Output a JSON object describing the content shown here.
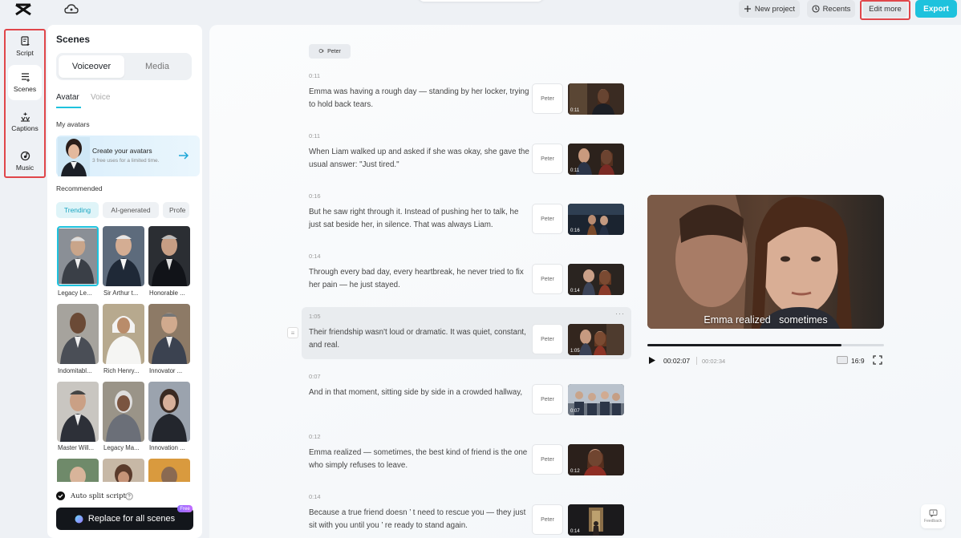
{
  "topbar": {
    "new_project": "New project",
    "recents": "Recents",
    "edit_more": "Edit more",
    "export": "Export"
  },
  "rail": {
    "items": [
      {
        "label": "Script",
        "icon": "script-icon"
      },
      {
        "label": "Scenes",
        "icon": "scenes-icon"
      },
      {
        "label": "Captions",
        "icon": "captions-icon"
      },
      {
        "label": "Music",
        "icon": "music-icon"
      }
    ]
  },
  "panel": {
    "title": "Scenes",
    "segments": [
      "Voiceover",
      "Media"
    ],
    "subtabs": [
      "Avatar",
      "Voice"
    ],
    "my_avatars": "My avatars",
    "banner_title": "Create your avatars",
    "banner_sub": "3 free uses for a limited time.",
    "recommended": "Recommended",
    "chips": [
      "Trending",
      "AI-generated",
      "Profe"
    ],
    "avatars": [
      {
        "name": "Legacy Le..."
      },
      {
        "name": "Sir Arthur t..."
      },
      {
        "name": "Honorable ..."
      },
      {
        "name": "Indomitabl..."
      },
      {
        "name": "Rich Henry..."
      },
      {
        "name": "Innovator ..."
      },
      {
        "name": "Master Will..."
      },
      {
        "name": "Legacy Ma..."
      },
      {
        "name": "Innovation ..."
      }
    ],
    "auto_split": "Auto split script",
    "replace": "Replace for all scenes",
    "free": "Free"
  },
  "script": {
    "speaker": "Peter",
    "scenes": [
      {
        "time": "0:11",
        "text": "Emma was having a rough day — standing by her locker, trying to hold back tears.",
        "voice": "Peter",
        "thumb_time": "0:11"
      },
      {
        "time": "0:11",
        "text": "When Liam walked up and asked if she was okay, she gave the usual answer: \"Just tired.\"",
        "voice": "Peter",
        "thumb_time": "0:11"
      },
      {
        "time": "0:16",
        "text": "But he saw right through it. Instead of pushing her to talk, he just sat beside her, in silence. That was always Liam.",
        "voice": "Peter",
        "thumb_time": "0:16"
      },
      {
        "time": "0:14",
        "text": "Through every bad day, every heartbreak, he never tried to fix her pain — he just stayed.",
        "voice": "Peter",
        "thumb_time": "0:14"
      },
      {
        "time": "1:05",
        "text": "Their friendship wasn't loud or dramatic. It was quiet, constant, and real.",
        "voice": "Peter",
        "thumb_time": "1:05"
      },
      {
        "time": "0:07",
        "text": "And in that moment, sitting side by side in a crowded hallway,",
        "voice": "Peter",
        "thumb_time": "0:07"
      },
      {
        "time": "0:12",
        "text": "Emma realized — sometimes, the best kind of friend is the one who simply refuses to leave.",
        "voice": "Peter",
        "thumb_time": "0:12"
      },
      {
        "time": "0:14",
        "text": "Because a true friend doesn ’ t need to rescue you — they just sit with you until you ’ re ready to stand again.",
        "voice": "Peter",
        "thumb_time": "0:14"
      }
    ],
    "more": "···"
  },
  "preview": {
    "caption": "Emma realized   sometimes",
    "current_time": "00:02:07",
    "total_time": "00:02:34",
    "progress": 0.82,
    "ratio": "16:9"
  },
  "feedback": "Feedback",
  "colors": {
    "accent": "#1ec2dd",
    "highlight_box": "#e0464a",
    "dark_button": "#13161b"
  }
}
